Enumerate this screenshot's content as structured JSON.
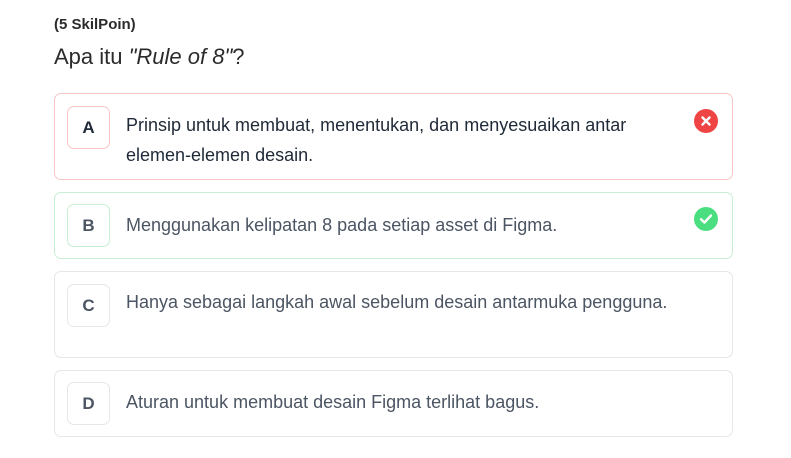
{
  "quiz": {
    "points": "(5 SkilPoin)",
    "question_prefix": "Apa itu ",
    "question_term": "\"Rule of 8\"",
    "question_suffix": "?",
    "options": [
      {
        "letter": "A",
        "text": "Prinsip untuk membuat, menentukan, dan menyesuaikan antar elemen-elemen desain.",
        "state": "wrong",
        "status_icon": "x-circle-icon"
      },
      {
        "letter": "B",
        "text": "Menggunakan kelipatan 8 pada setiap asset di Figma.",
        "state": "correct",
        "status_icon": "check-circle-icon"
      },
      {
        "letter": "C",
        "text": "Hanya sebagai langkah awal sebelum desain antarmuka pengguna.",
        "state": "neutral"
      },
      {
        "letter": "D",
        "text": "Aturan untuk membuat desain Figma terlihat bagus.",
        "state": "neutral"
      }
    ]
  },
  "colors": {
    "wrong_border": "#f9c6c6",
    "wrong_icon": "#ef4444",
    "correct_border": "#c7efd3",
    "correct_icon": "#4ade80",
    "neutral_border": "#e5e7eb"
  }
}
